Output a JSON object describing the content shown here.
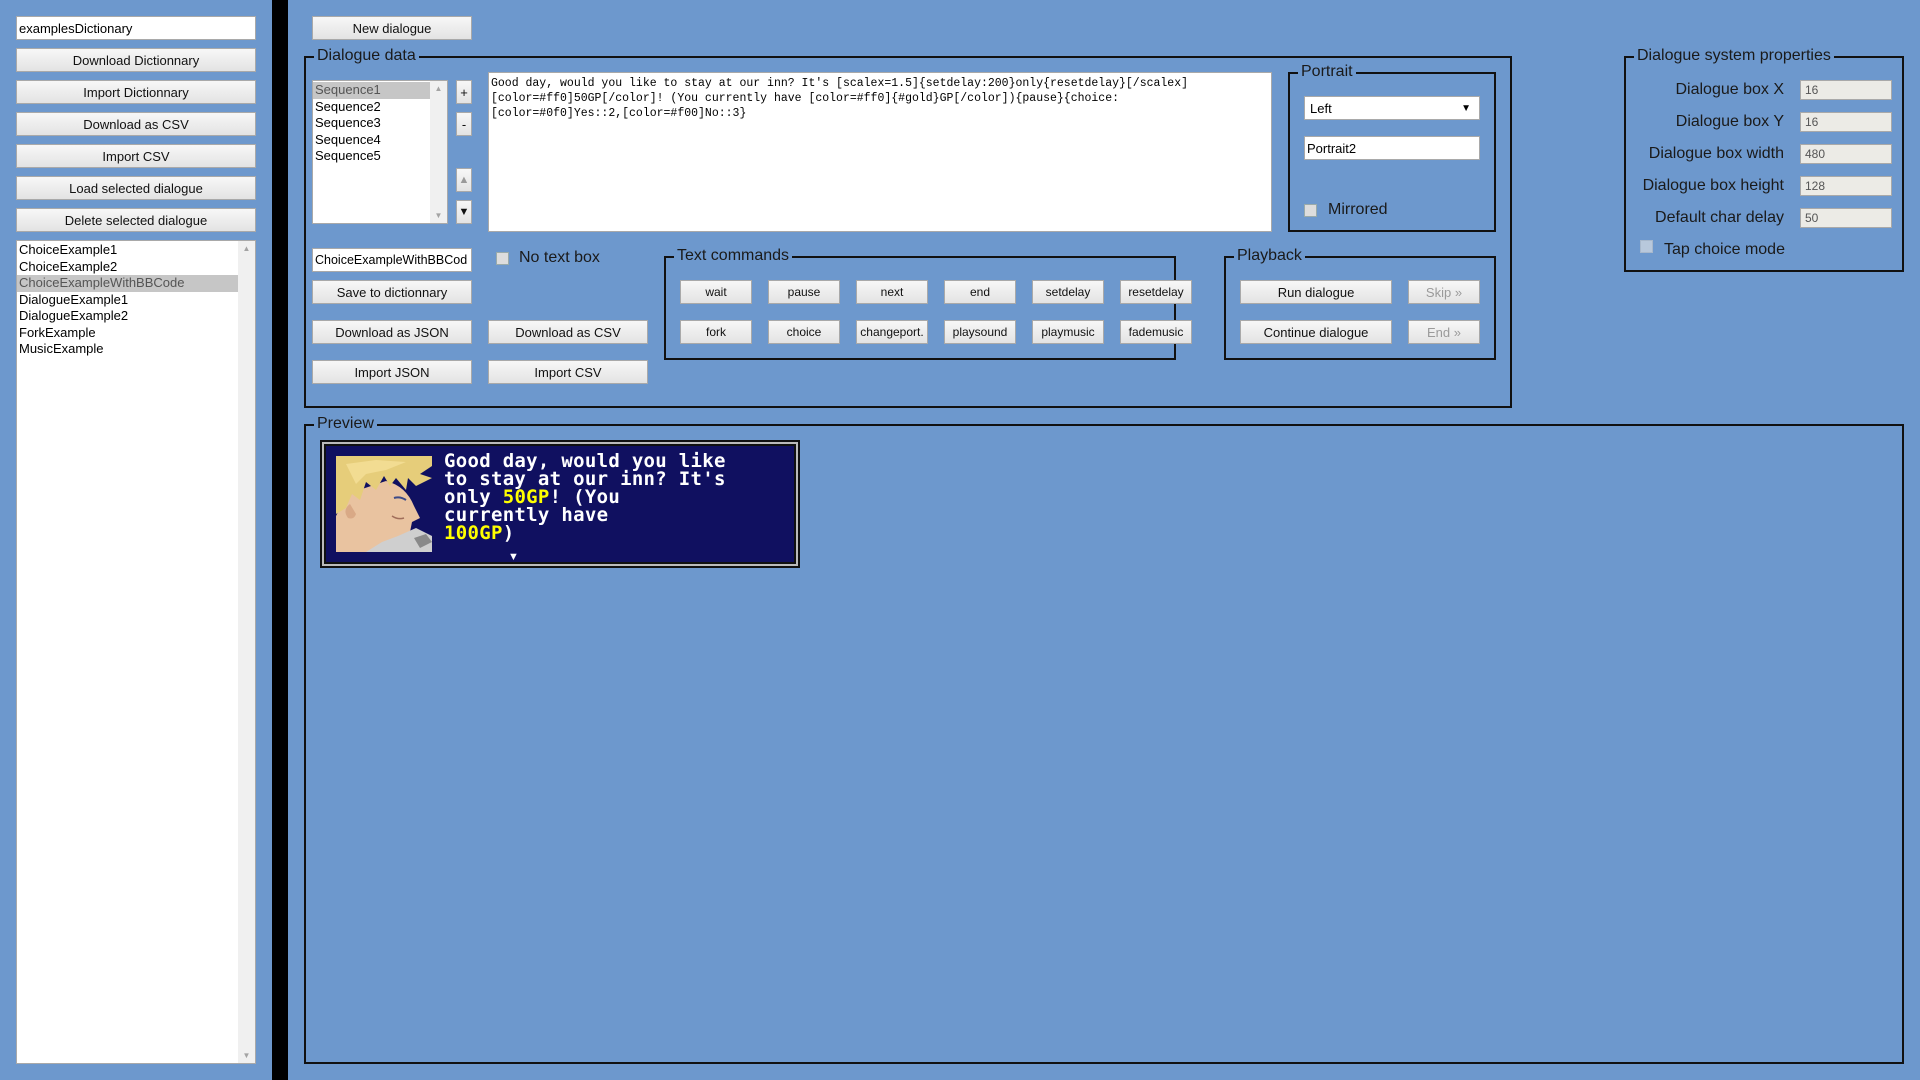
{
  "sidebar": {
    "dictionary_name": "examplesDictionary",
    "buttons": {
      "download_dictionary": "Download Dictionnary",
      "import_dictionary": "Import Dictionnary",
      "download_csv": "Download as CSV",
      "import_csv": "Import CSV",
      "load_selected": "Load selected dialogue",
      "delete_selected": "Delete selected dialogue"
    },
    "dialogues": [
      {
        "label": "ChoiceExample1",
        "selected": false
      },
      {
        "label": "ChoiceExample2",
        "selected": false
      },
      {
        "label": "ChoiceExampleWithBBCode",
        "selected": true
      },
      {
        "label": "DialogueExample1",
        "selected": false
      },
      {
        "label": "DialogueExample2",
        "selected": false
      },
      {
        "label": "ForkExample",
        "selected": false
      },
      {
        "label": "MusicExample",
        "selected": false
      }
    ]
  },
  "main": {
    "new_dialogue_label": "New dialogue",
    "dialogue_data": {
      "legend": "Dialogue data",
      "sequences": [
        {
          "label": "Sequence1",
          "selected": true
        },
        {
          "label": "Sequence2",
          "selected": false
        },
        {
          "label": "Sequence3",
          "selected": false
        },
        {
          "label": "Sequence4",
          "selected": false
        },
        {
          "label": "Sequence5",
          "selected": false
        }
      ],
      "add_label": "+",
      "remove_label": "-",
      "move_up_label": "▲",
      "move_down_label": "▼",
      "text": "Good day, would you like to stay at our inn? It's [scalex=1.5]{setdelay:200}only{resetdelay}[/scalex]\n[color=#ff0]50GP[/color]! (You currently have [color=#ff0]{#gold}GP[/color]){pause}{choice:\n[color=#0f0]Yes::2,[color=#f00]No::3}",
      "portrait": {
        "legend": "Portrait",
        "position": "Left",
        "name": "Portrait2",
        "mirrored_label": "Mirrored",
        "mirrored": false
      },
      "dialogue_name": "ChoiceExampleWithBBCod",
      "no_text_box_label": "No text box",
      "no_text_box": false,
      "save_label": "Save to dictionnary",
      "download_json_label": "Download as JSON",
      "download_csv_label": "Download as CSV",
      "import_json_label": "Import JSON",
      "import_csv_label": "Import CSV",
      "text_commands": {
        "legend": "Text commands",
        "row1": [
          "wait",
          "pause",
          "next",
          "end",
          "setdelay",
          "resetdelay"
        ],
        "row2": [
          "fork",
          "choice",
          "changeport.",
          "playsound",
          "playmusic",
          "fademusic"
        ]
      },
      "playback": {
        "legend": "Playback",
        "run_label": "Run dialogue",
        "continue_label": "Continue dialogue",
        "skip_label": "Skip »",
        "end_label": "End »"
      }
    },
    "properties": {
      "legend": "Dialogue system properties",
      "fields": [
        {
          "label": "Dialogue box X",
          "value": "16"
        },
        {
          "label": "Dialogue box Y",
          "value": "16"
        },
        {
          "label": "Dialogue box width",
          "value": "480"
        },
        {
          "label": "Dialogue box height",
          "value": "128"
        },
        {
          "label": "Default char delay",
          "value": "50"
        }
      ],
      "tap_choice_label": "Tap choice mode",
      "tap_choice": false
    },
    "preview": {
      "legend": "Preview",
      "lines": [
        [
          {
            "t": "Good day, would you like",
            "c": "white"
          }
        ],
        [
          {
            "t": "to stay at our inn? It's",
            "c": "white"
          }
        ],
        [
          {
            "t": "only ",
            "c": "white"
          },
          {
            "t": "50GP",
            "c": "gold"
          },
          {
            "t": "! (You",
            "c": "white"
          }
        ],
        [
          {
            "t": "currently have",
            "c": "white"
          }
        ],
        [
          {
            "t": "100GP",
            "c": "gold"
          },
          {
            "t": ")",
            "c": "white"
          }
        ]
      ],
      "continue_indicator": "▼",
      "colors": {
        "box_bg": "#101060",
        "white": "#ffffff",
        "gold": "#ffff00"
      }
    }
  }
}
